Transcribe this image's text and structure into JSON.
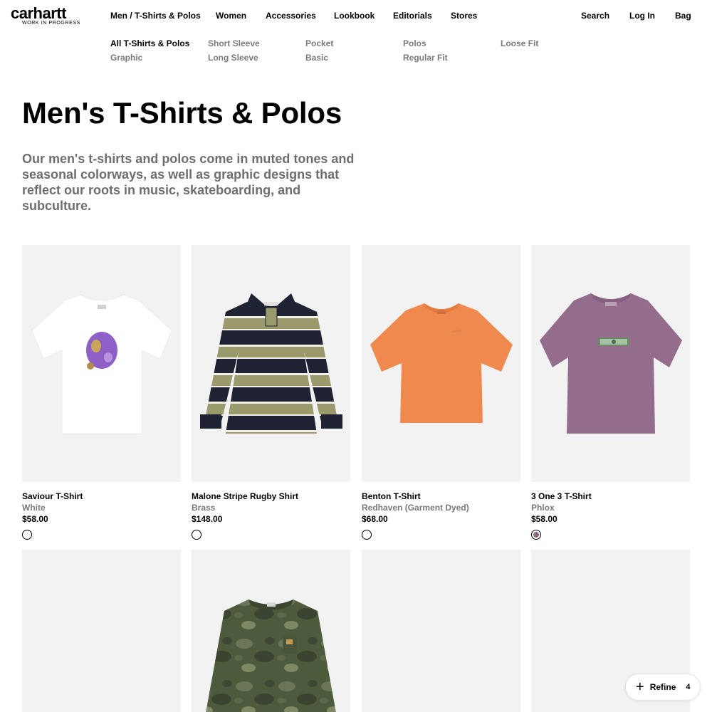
{
  "brand": {
    "name": "carhartt",
    "tagline": "WORK IN PROGRESS"
  },
  "topnav": {
    "breadcrumb": "Men / T-Shirts & Polos",
    "women": "Women",
    "accessories": "Accessories",
    "lookbook": "Lookbook",
    "editorials": "Editorials",
    "stores": "Stores",
    "search": "Search",
    "login": "Log In",
    "bag": "Bag"
  },
  "subnav": {
    "all": "All T-Shirts & Polos",
    "graphic": "Graphic",
    "short_sleeve": "Short Sleeve",
    "long_sleeve": "Long Sleeve",
    "pocket": "Pocket",
    "basic": "Basic",
    "polos": "Polos",
    "regular_fit": "Regular Fit",
    "loose_fit": "Loose Fit"
  },
  "page": {
    "title": "Men's T-Shirts & Polos",
    "description": "Our men's t-shirts and polos come in muted tones and seasonal colorways, as well as graphic designs that reflect our roots in music, skateboarding, and subculture."
  },
  "products": [
    {
      "name": "Saviour T-Shirt",
      "color": "White",
      "price": "$58.00",
      "swatch": "#ffffff",
      "garment": "#ffffff"
    },
    {
      "name": "Malone Stripe Rugby Shirt",
      "color": "Brass",
      "price": "$148.00",
      "swatch": "#ffffff",
      "garment": "#9a9a6c"
    },
    {
      "name": "Benton T-Shirt",
      "color": "Redhaven (Garment Dyed)",
      "price": "$68.00",
      "swatch": "#ffffff",
      "garment": "#f0894e"
    },
    {
      "name": "3 One 3 T-Shirt",
      "color": "Phlox",
      "price": "$58.00",
      "swatch": "#8f6a84",
      "garment": "#946d8c"
    }
  ],
  "refine": {
    "label": "Refine",
    "count": "4"
  },
  "colors": {
    "accent": "#000000",
    "muted_text": "#7a7a7a",
    "image_bg": "#f2f2f2"
  }
}
